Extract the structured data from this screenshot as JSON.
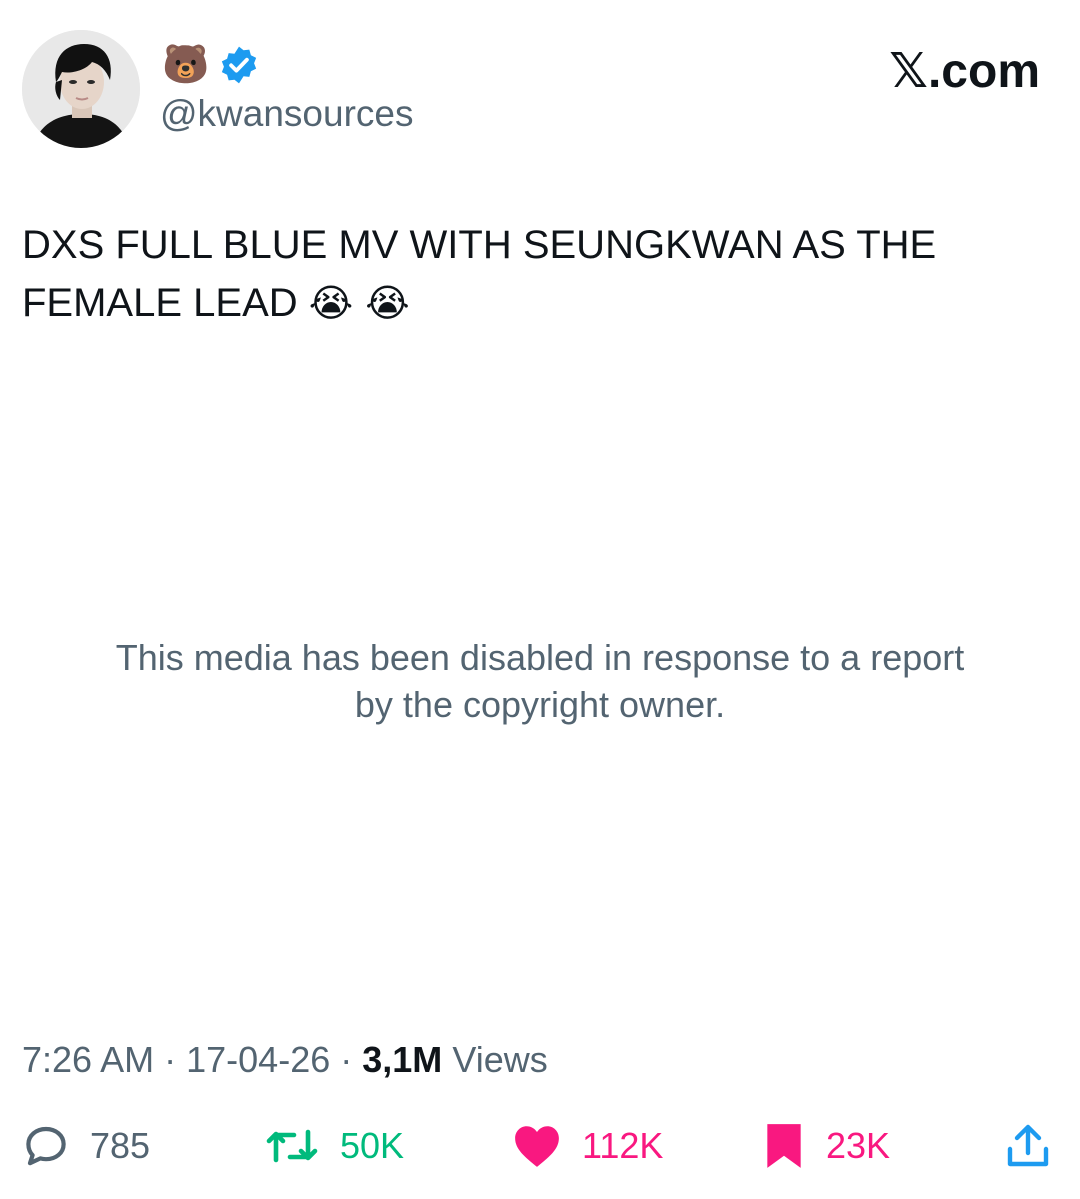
{
  "user": {
    "display_name_emoji": "🐻",
    "handle": "@kwansources",
    "avatar_icon": "profile-photo",
    "verified_icon": "verified-badge-icon",
    "verified_color": "#1d9bf0"
  },
  "brand": {
    "label": "𝕏.com"
  },
  "tweet": {
    "text": "DXS FULL BLUE MV WITH SEUNGKWAN AS THE FEMALE LEAD",
    "emojis": "😭 😭",
    "media_notice_line1": "This media has been disabled in response to a report",
    "media_notice_line2": "by the copyright owner."
  },
  "meta": {
    "time": "7:26 AM",
    "separator": "·",
    "date": "17-04-26",
    "views_count": "3,1M",
    "views_label": "Views"
  },
  "actions": {
    "reply": {
      "icon": "reply-bubble-icon",
      "count": "785",
      "color": "#536471"
    },
    "retweet": {
      "icon": "retweet-icon",
      "count": "50K",
      "color": "#00ba7c"
    },
    "like": {
      "icon": "heart-icon",
      "count": "112K",
      "color": "#f91880"
    },
    "bookmark": {
      "icon": "bookmark-icon",
      "count": "23K",
      "color": "#f91880"
    },
    "share": {
      "icon": "share-icon",
      "color": "#1d9bf0"
    }
  }
}
